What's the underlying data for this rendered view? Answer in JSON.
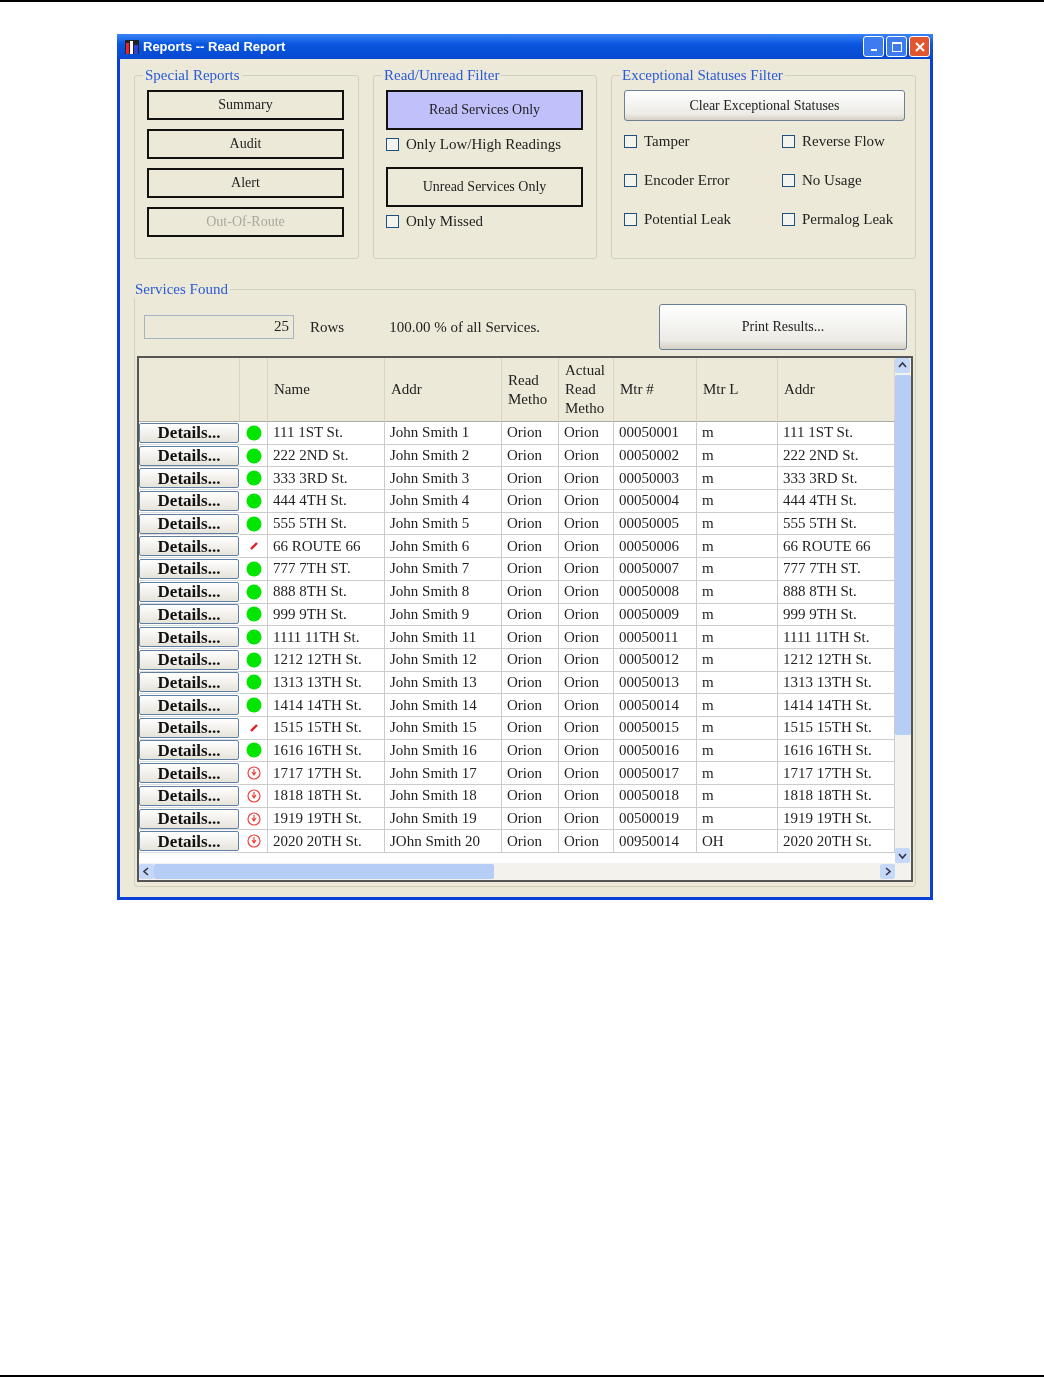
{
  "window": {
    "title": "Reports  -- Read Report"
  },
  "special_reports": {
    "title": "Special Reports",
    "buttons": [
      {
        "label": "Summary",
        "disabled": false
      },
      {
        "label": "Audit",
        "disabled": false
      },
      {
        "label": "Alert",
        "disabled": false
      },
      {
        "label": "Out-Of-Route",
        "disabled": true
      }
    ]
  },
  "read_filter": {
    "title": "Read/Unread Filter",
    "items": [
      {
        "kind": "button",
        "label": "Read Services Only",
        "selected": true
      },
      {
        "kind": "checkbox",
        "label": "Only Low/High Readings",
        "checked": false
      },
      {
        "kind": "button",
        "label": "Unread Services Only",
        "selected": false
      },
      {
        "kind": "checkbox",
        "label": "Only Missed",
        "checked": false
      }
    ]
  },
  "exceptional_filter": {
    "title": "Exceptional Statuses Filter",
    "clear_button": "Clear Exceptional Statuses",
    "checkboxes": [
      {
        "label": "Tamper",
        "checked": false
      },
      {
        "label": "Reverse Flow",
        "checked": false
      },
      {
        "label": "Encoder Error",
        "checked": false
      },
      {
        "label": "No Usage",
        "checked": false
      },
      {
        "label": "Potential Leak",
        "checked": false
      },
      {
        "label": "Permalog Leak",
        "checked": false
      }
    ]
  },
  "services_found": {
    "title": "Services Found",
    "count": "25",
    "rows_label": "Rows",
    "percent": "100.00 % of all Services.",
    "print_button": "Print Results..."
  },
  "table": {
    "columns": [
      "Name",
      "Addr",
      "Read Metho",
      "Actual Read Metho",
      "Mtr #",
      "Mtr L",
      "Addr"
    ],
    "rows": [
      {
        "button": "Details...",
        "status": {
          "kind": "ok"
        },
        "cells": [
          "111 1ST St.",
          "John Smith 1",
          "Orion",
          "Orion",
          "00050001",
          "m",
          "111 1ST St."
        ]
      },
      {
        "button": "Details...",
        "status": {
          "kind": "ok"
        },
        "cells": [
          "222 2ND St.",
          "John Smith 2",
          "Orion",
          "Orion",
          "00050002",
          "m",
          "222 2ND St."
        ]
      },
      {
        "button": "Details...",
        "status": {
          "kind": "ok"
        },
        "cells": [
          "333 3RD St.",
          "John Smith 3",
          "Orion",
          "Orion",
          "00050003",
          "m",
          "333 3RD St."
        ]
      },
      {
        "button": "Details...",
        "status": {
          "kind": "ok"
        },
        "cells": [
          "444 4TH St.",
          "John Smith 4",
          "Orion",
          "Orion",
          "00050004",
          "m",
          "444 4TH St."
        ]
      },
      {
        "button": "Details...",
        "status": {
          "kind": "ok"
        },
        "cells": [
          "555 5TH St.",
          "John Smith 5",
          "Orion",
          "Orion",
          "00050005",
          "m",
          "555 5TH St."
        ]
      },
      {
        "button": "Details...",
        "status": {
          "kind": "flag"
        },
        "cells": [
          "66 ROUTE 66",
          "John Smith 6",
          "Orion",
          "Orion",
          "00050006",
          "m",
          "66 ROUTE 66"
        ]
      },
      {
        "button": "Details...",
        "status": {
          "kind": "ok"
        },
        "cells": [
          "777 7TH ST.",
          "John Smith 7",
          "Orion",
          "Orion",
          "00050007",
          "m",
          "777 7TH ST."
        ]
      },
      {
        "button": "Details...",
        "status": {
          "kind": "ok"
        },
        "cells": [
          "888 8TH St.",
          "John Smith 8",
          "Orion",
          "Orion",
          "00050008",
          "m",
          "888 8TH St."
        ]
      },
      {
        "button": "Details...",
        "status": {
          "kind": "ok"
        },
        "cells": [
          "999 9TH St.",
          "John Smith 9",
          "Orion",
          "Orion",
          "00050009",
          "m",
          "999 9TH St."
        ]
      },
      {
        "button": "Details...",
        "status": {
          "kind": "ok"
        },
        "cells": [
          "1111 11TH St.",
          "John Smith 11",
          "Orion",
          "Orion",
          "00050011",
          "m",
          "1111 11TH St."
        ]
      },
      {
        "button": "Details...",
        "status": {
          "kind": "ok"
        },
        "cells": [
          "1212 12TH St.",
          "John Smith 12",
          "Orion",
          "Orion",
          "00050012",
          "m",
          "1212 12TH St."
        ]
      },
      {
        "button": "Details...",
        "status": {
          "kind": "ok"
        },
        "cells": [
          "1313 13TH St.",
          "John Smith 13",
          "Orion",
          "Orion",
          "00050013",
          "m",
          "1313 13TH St."
        ]
      },
      {
        "button": "Details...",
        "status": {
          "kind": "ok"
        },
        "cells": [
          "1414 14TH St.",
          "John Smith 14",
          "Orion",
          "Orion",
          "00050014",
          "m",
          "1414 14TH St."
        ]
      },
      {
        "button": "Details...",
        "status": {
          "kind": "flag"
        },
        "cells": [
          "1515 15TH St.",
          "John Smith 15",
          "Orion",
          "Orion",
          "00050015",
          "m",
          "1515 15TH St."
        ]
      },
      {
        "button": "Details...",
        "status": {
          "kind": "ok"
        },
        "cells": [
          "1616 16TH St.",
          "John Smith 16",
          "Orion",
          "Orion",
          "00050016",
          "m",
          "1616 16TH St."
        ]
      },
      {
        "button": "Details...",
        "status": {
          "kind": "alert"
        },
        "cells": [
          "1717 17TH St.",
          "John Smith 17",
          "Orion",
          "Orion",
          "00050017",
          "m",
          "1717 17TH St."
        ]
      },
      {
        "button": "Details...",
        "status": {
          "kind": "alert"
        },
        "cells": [
          "1818 18TH St.",
          "John Smith 18",
          "Orion",
          "Orion",
          "00050018",
          "m",
          "1818 18TH St."
        ]
      },
      {
        "button": "Details...",
        "status": {
          "kind": "alert"
        },
        "cells": [
          "1919 19TH St.",
          "John Smith 19",
          "Orion",
          "Orion",
          "00500019",
          "m",
          "1919 19TH St."
        ]
      },
      {
        "button": "Details...",
        "status": {
          "kind": "alert"
        },
        "cells": [
          "2020 20TH St.",
          "JOhn Smith 20",
          "Orion",
          "Orion",
          "00950014",
          "OH",
          "2020 20TH St."
        ]
      }
    ]
  }
}
